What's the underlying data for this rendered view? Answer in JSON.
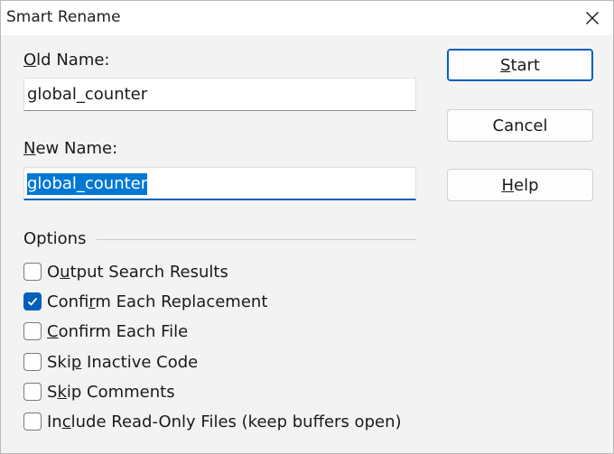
{
  "window": {
    "title": "Smart Rename",
    "close_glyph": "✕"
  },
  "old_name": {
    "label": "Old Name:",
    "value": "global_counter"
  },
  "new_name": {
    "label": "New Name:",
    "value": "global_counter"
  },
  "buttons": {
    "start": "Start",
    "cancel": "Cancel",
    "help": "Help"
  },
  "options": {
    "group_label": "Options",
    "items": [
      {
        "label": "Output Search Results",
        "checked": false
      },
      {
        "label": "Confirm Each Replacement",
        "checked": true
      },
      {
        "label": "Confirm Each File",
        "checked": false
      },
      {
        "label": "Skip Inactive Code",
        "checked": false
      },
      {
        "label": "Skip Comments",
        "checked": false
      },
      {
        "label": "Include Read-Only Files (keep buffers open)",
        "checked": false
      }
    ]
  },
  "icons": {
    "close": "close-icon",
    "check": "checkmark-icon"
  },
  "colors": {
    "accent": "#005fb8",
    "selection": "#0078d4",
    "dialog_bg": "#f3f3f3",
    "titlebar_bg": "#ffffff"
  }
}
